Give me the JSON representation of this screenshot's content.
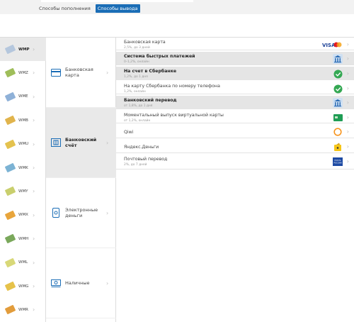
{
  "tabs": [
    {
      "label": "Способы пополнения",
      "active": false
    },
    {
      "label": "Способы вывода",
      "active": true
    }
  ],
  "wallets": [
    {
      "code": "WMP",
      "color": "#b5c7dd",
      "active": true
    },
    {
      "code": "WMZ",
      "color": "#9fbe5a",
      "active": false
    },
    {
      "code": "WME",
      "color": "#8fb1d8",
      "active": false
    },
    {
      "code": "WMB",
      "color": "#e1b44c",
      "active": false
    },
    {
      "code": "WMU",
      "color": "#e4c24e",
      "active": false
    },
    {
      "code": "WMK",
      "color": "#7cb3d4",
      "active": false
    },
    {
      "code": "WMY",
      "color": "#c9cf6d",
      "active": false
    },
    {
      "code": "WMX",
      "color": "#e8a53c",
      "active": false
    },
    {
      "code": "WMH",
      "color": "#7aa85b",
      "active": false
    },
    {
      "code": "WML",
      "color": "#d8d878",
      "active": false
    },
    {
      "code": "WMG",
      "color": "#e6c24a",
      "active": false
    },
    {
      "code": "WMR",
      "color": "#e29c3b",
      "active": false
    }
  ],
  "methods": [
    {
      "label": "Банковская карта",
      "icon": "card-icon",
      "active": false
    },
    {
      "label": "Банковский счёт",
      "icon": "bank-account-icon",
      "active": true
    },
    {
      "label": "Электронные деньги",
      "icon": "wallet-icon",
      "active": false
    },
    {
      "label": "Наличные",
      "icon": "cash-icon",
      "active": false
    }
  ],
  "options": [
    {
      "title": "Банковская карта",
      "subtitle": "2,5%, до 3 дней",
      "badge": "visa-mastercard-icon",
      "highlight": false
    },
    {
      "title": "Система быстрых платежей",
      "subtitle": "0–1,2%, онлайн",
      "badge": "bank-building-icon",
      "highlight": true
    },
    {
      "title": "На счет в Сбербанке",
      "subtitle": "1,2%, до 1 дня",
      "badge": "sberbank-icon",
      "highlight": true
    },
    {
      "title": "На карту Сбербанка по номеру телефона",
      "subtitle": "1,2%, онлайн",
      "badge": "sberbank-icon",
      "highlight": false
    },
    {
      "title": "Банковский перевод",
      "subtitle": "от 1,8%, до 1 дня",
      "badge": "bank-building-icon",
      "highlight": true
    },
    {
      "title": "Моментальный выпуск виртуальной карты",
      "subtitle": "от 1,2%, онлайн",
      "badge": "virtual-card-icon",
      "highlight": false
    },
    {
      "title": "Qiwi",
      "subtitle": "",
      "badge": "qiwi-icon",
      "highlight": false
    },
    {
      "title": "Яндекс.Деньги",
      "subtitle": "",
      "badge": "yandex-money-icon",
      "highlight": false
    },
    {
      "title": "Почтовый перевод",
      "subtitle": "2%, до 7 дней",
      "badge": "post-icon",
      "highlight": false
    }
  ],
  "visa_text": "VISA",
  "post_text": "ПОЧТА РОССИИ"
}
